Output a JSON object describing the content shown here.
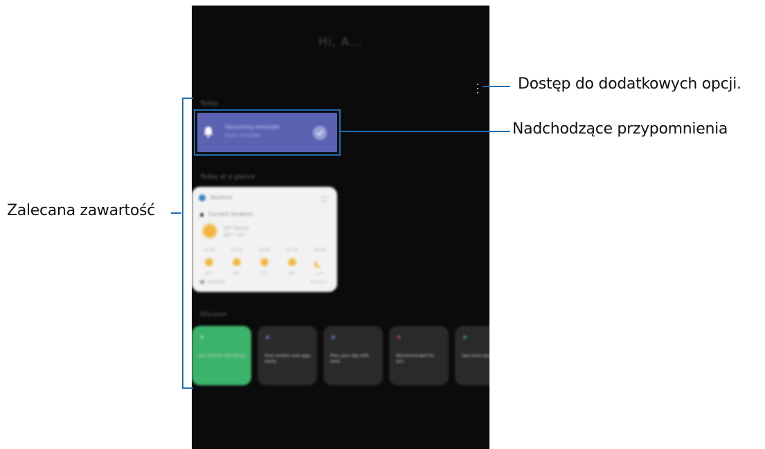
{
  "phone": {
    "greeting": "Hi, A...",
    "reminders_label": "Today",
    "reminder": {
      "title": "Upcoming reminder",
      "subtitle": "Daily reminder",
      "accent": "#5b62b2"
    },
    "today_label": "Today at a glance",
    "weather": {
      "app": "Weather",
      "location": "Current location",
      "temp_line1": "23° Sunny",
      "temp_line2": "25° / 15°",
      "forecast": [
        {
          "time": "12:00",
          "icon": "sun-icon",
          "temp": "23°"
        },
        {
          "time": "15:00",
          "icon": "sun-icon",
          "temp": "24°"
        },
        {
          "time": "18:00",
          "icon": "sun-icon",
          "temp": "22°"
        },
        {
          "time": "21:00",
          "icon": "sun-icon",
          "temp": "20°"
        },
        {
          "time": "00:00",
          "icon": "moon-icon",
          "temp": "17°"
        }
      ],
      "footer": "Updated",
      "footer_right": "Weather"
    },
    "discover_label": "Discover",
    "discover_cards": [
      {
        "text": "Get started with Bixby",
        "color": "#3cb36a"
      },
      {
        "text": "Find content and apps easily",
        "color": "#2a2a2a"
      },
      {
        "text": "Plan your day with ease",
        "color": "#2a2a2a"
      },
      {
        "text": "Recommended for you",
        "color": "#2a2a2a"
      },
      {
        "text": "See more tips",
        "color": "#2a2a2a"
      }
    ]
  },
  "callouts": {
    "more_options": "Dostęp do dodatkowych opcji.",
    "upcoming_reminders": "Nadchodzące przypomnienia",
    "recommended_content": "Zalecana zawartość"
  },
  "colors": {
    "leader": "#1f6fb0",
    "phone_bg": "#0b0b0b"
  }
}
